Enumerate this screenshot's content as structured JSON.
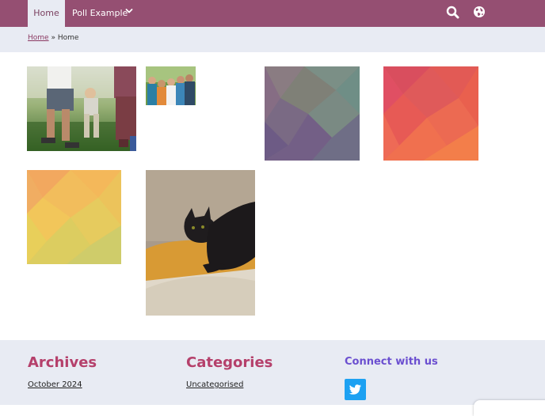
{
  "nav": {
    "home_label": "Home",
    "poll_label": "Poll Example"
  },
  "breadcrumb": {
    "link_label": "Home",
    "separator": "»",
    "current": "Home"
  },
  "footer": {
    "archives_title": "Archives",
    "archives_link": "October 2024",
    "categories_title": "Categories",
    "categories_link": "Uncategorised",
    "connect_title": "Connect with us"
  },
  "colors": {
    "nav_bg": "#954f72",
    "band_bg": "#e8ebf3",
    "heading_accent": "#b5406b",
    "connect_accent": "#6b4fd0",
    "twitter": "#1da1f2"
  }
}
